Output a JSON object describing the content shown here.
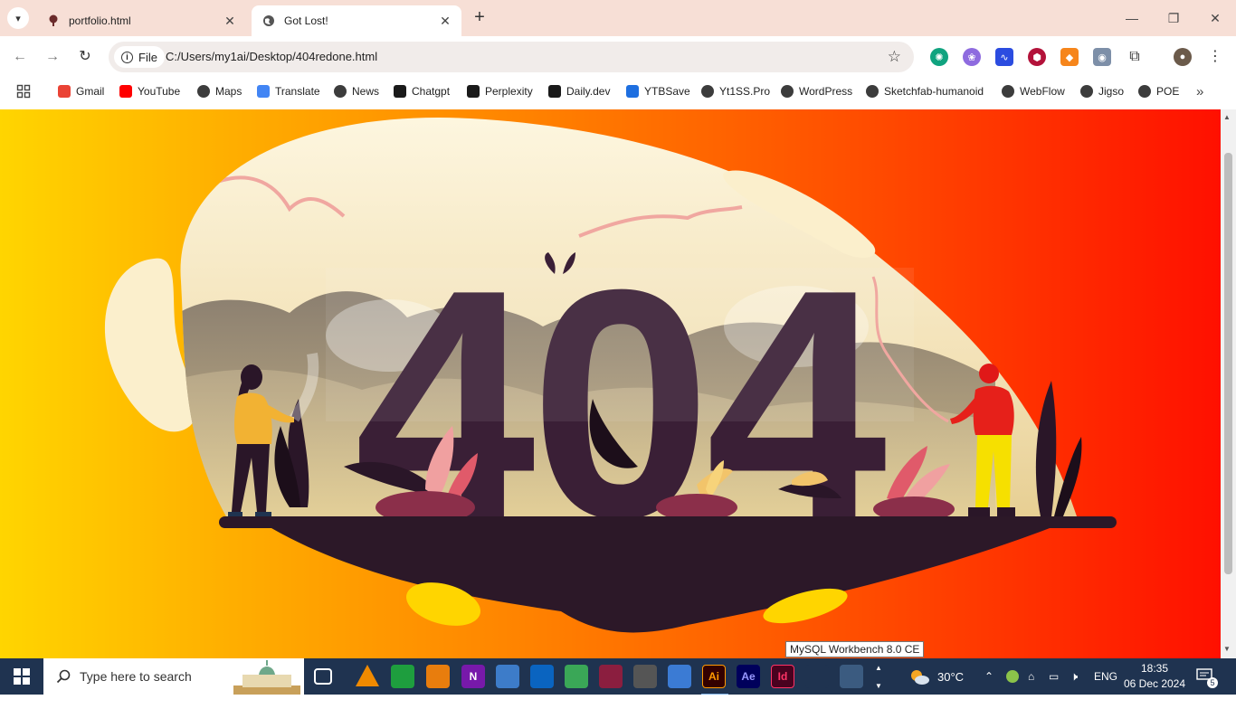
{
  "tabs": [
    {
      "title": "portfolio.html"
    },
    {
      "title": "Got Lost!"
    }
  ],
  "address": {
    "chip_label": "File",
    "url": "C:/Users/my1ai/Desktop/404redone.html"
  },
  "bookmarks": [
    {
      "label": "Gmail",
      "icon": "gmail-icon",
      "color": "#ea4335"
    },
    {
      "label": "YouTube",
      "icon": "youtube-icon",
      "color": "#ff0000"
    },
    {
      "label": "Maps",
      "icon": "globe-icon",
      "color": "#3c3c3c"
    },
    {
      "label": "Translate",
      "icon": "translate-icon",
      "color": "#4285f4"
    },
    {
      "label": "News",
      "icon": "globe-icon",
      "color": "#3c3c3c"
    },
    {
      "label": "Chatgpt",
      "icon": "chatgpt-icon",
      "color": "#1a1a1a"
    },
    {
      "label": "Perplexity",
      "icon": "perplexity-icon",
      "color": "#1a1a1a"
    },
    {
      "label": "Daily.dev",
      "icon": "dailydev-icon",
      "color": "#1a1a1a"
    },
    {
      "label": "YTBSave",
      "icon": "ytbsave-icon",
      "color": "#1e6fe0"
    },
    {
      "label": "Yt1SS.Pro",
      "icon": "globe-icon",
      "color": "#3c3c3c"
    },
    {
      "label": "WordPress",
      "icon": "globe-icon",
      "color": "#3c3c3c"
    },
    {
      "label": "Sketchfab-humanoid",
      "icon": "globe-icon",
      "color": "#3c3c3c"
    },
    {
      "label": "WebFlow",
      "icon": "globe-icon",
      "color": "#3c3c3c"
    },
    {
      "label": "Jigso",
      "icon": "globe-icon",
      "color": "#3c3c3c"
    },
    {
      "label": "POE",
      "icon": "globe-icon",
      "color": "#3c3c3c"
    }
  ],
  "page": {
    "heading": "404"
  },
  "tooltip": "MySQL Workbench 8.0 CE",
  "taskbar": {
    "search_placeholder": "Type here to search",
    "weather": "30°C",
    "language": "ENG",
    "time": "18:35",
    "date": "06 Dec 2024",
    "notifications": "5",
    "apps": [
      {
        "name": "task-view-icon",
        "label": "",
        "color": "#1f3350"
      },
      {
        "name": "vlc-icon",
        "label": "",
        "color": "#f08a00"
      },
      {
        "name": "sheets-icon",
        "label": "",
        "color": "#1e9e3e"
      },
      {
        "name": "blender-icon",
        "label": "",
        "color": "#e87d0d"
      },
      {
        "name": "onenote-icon",
        "label": "N",
        "color": "#7719aa"
      },
      {
        "name": "browser-window-icon",
        "label": "",
        "color": "#3d7cc9"
      },
      {
        "name": "remote-desktop-icon",
        "label": "",
        "color": "#0a64c0"
      },
      {
        "name": "money-manager-icon",
        "label": "",
        "color": "#3aa757"
      },
      {
        "name": "winrar-icon",
        "label": "",
        "color": "#8b1e3f"
      },
      {
        "name": "media-player-icon",
        "label": "",
        "color": "#555555"
      },
      {
        "name": "video-player-icon",
        "label": "",
        "color": "#3b7bd4"
      },
      {
        "name": "illustrator-icon",
        "label": "Ai",
        "color": "#330000"
      },
      {
        "name": "after-effects-icon",
        "label": "Ae",
        "color": "#00005b"
      },
      {
        "name": "indesign-icon",
        "label": "Id",
        "color": "#49021f"
      },
      {
        "name": "vscode-icon",
        "label": "",
        "color": "#1f3350"
      },
      {
        "name": "mysql-workbench-icon",
        "label": "",
        "color": "#3b5b80"
      }
    ]
  },
  "colors": {
    "tabstrip": "#f7dfd6",
    "dark_plum": "#3a1f36",
    "cream": "#fbf3dc"
  }
}
